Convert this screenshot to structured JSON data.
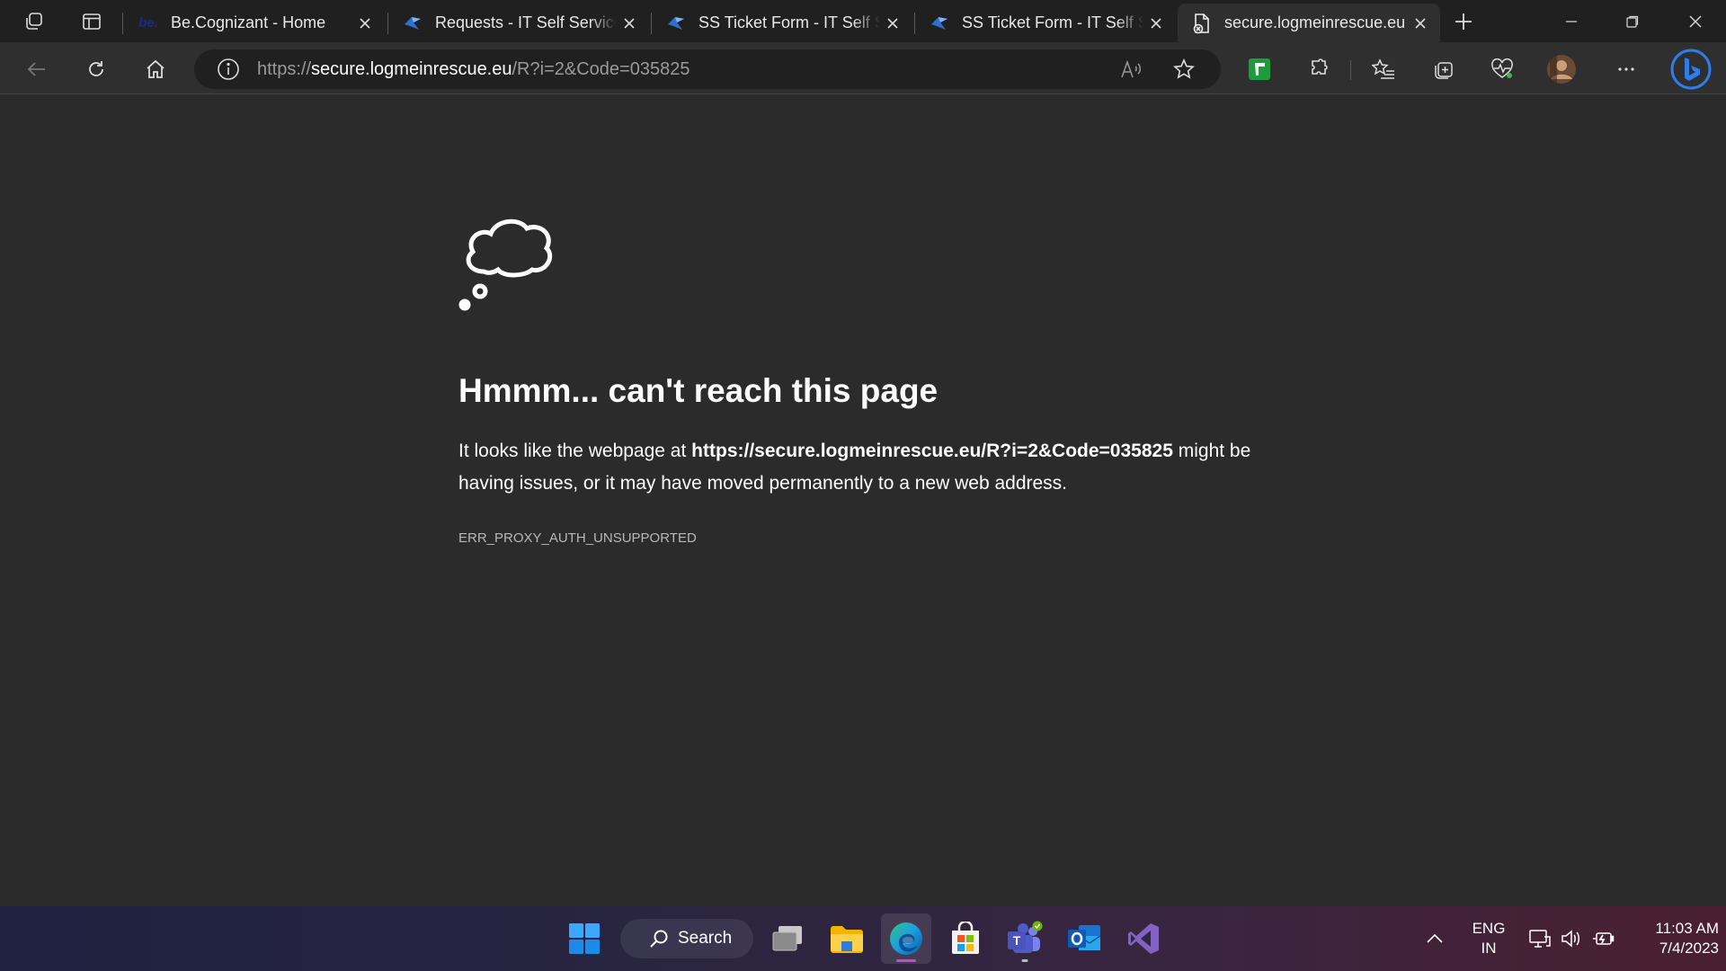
{
  "tabs": [
    {
      "title": "Be.Cognizant - Home",
      "favicon": "becognizant-icon",
      "favicon_text": "be."
    },
    {
      "title": "Requests - IT Self Service",
      "favicon": "servicenow-icon"
    },
    {
      "title": "SS Ticket Form - IT Self Service",
      "favicon": "servicenow-icon"
    },
    {
      "title": "SS Ticket Form - IT Self Service",
      "favicon": "servicenow-icon"
    },
    {
      "title": "secure.logmeinrescue.eu",
      "favicon": "page-error-icon",
      "active": true
    }
  ],
  "address_bar": {
    "scheme": "https://",
    "host": "secure.logmeinrescue.eu",
    "path": "/R?i=2&Code=035825"
  },
  "error_page": {
    "heading": "Hmmm... can't reach this page",
    "text_before": "It looks like the webpage at ",
    "url": "https://secure.logmeinrescue.eu/R?i=2&Code=035825",
    "text_after": " might be having issues, or it may have moved permanently to a new web address.",
    "error_code": "ERR_PROXY_AUTH_UNSUPPORTED"
  },
  "taskbar": {
    "search_label": "Search",
    "apps": [
      "start-icon",
      "search",
      "task-view-icon",
      "file-explorer-icon",
      "edge-icon",
      "store-icon",
      "teams-icon",
      "outlook-icon",
      "visual-studio-icon"
    ],
    "language": {
      "line1": "ENG",
      "line2": "IN"
    },
    "clock": {
      "time": "11:03 AM",
      "date": "7/4/2023"
    }
  },
  "colors": {
    "page_bg": "#2b2b2b",
    "tabstrip_bg": "#202020",
    "toolbar_bg": "#2f2f2f",
    "edge_accent": "#c04ad0",
    "bing_blue": "#2e7de9"
  }
}
